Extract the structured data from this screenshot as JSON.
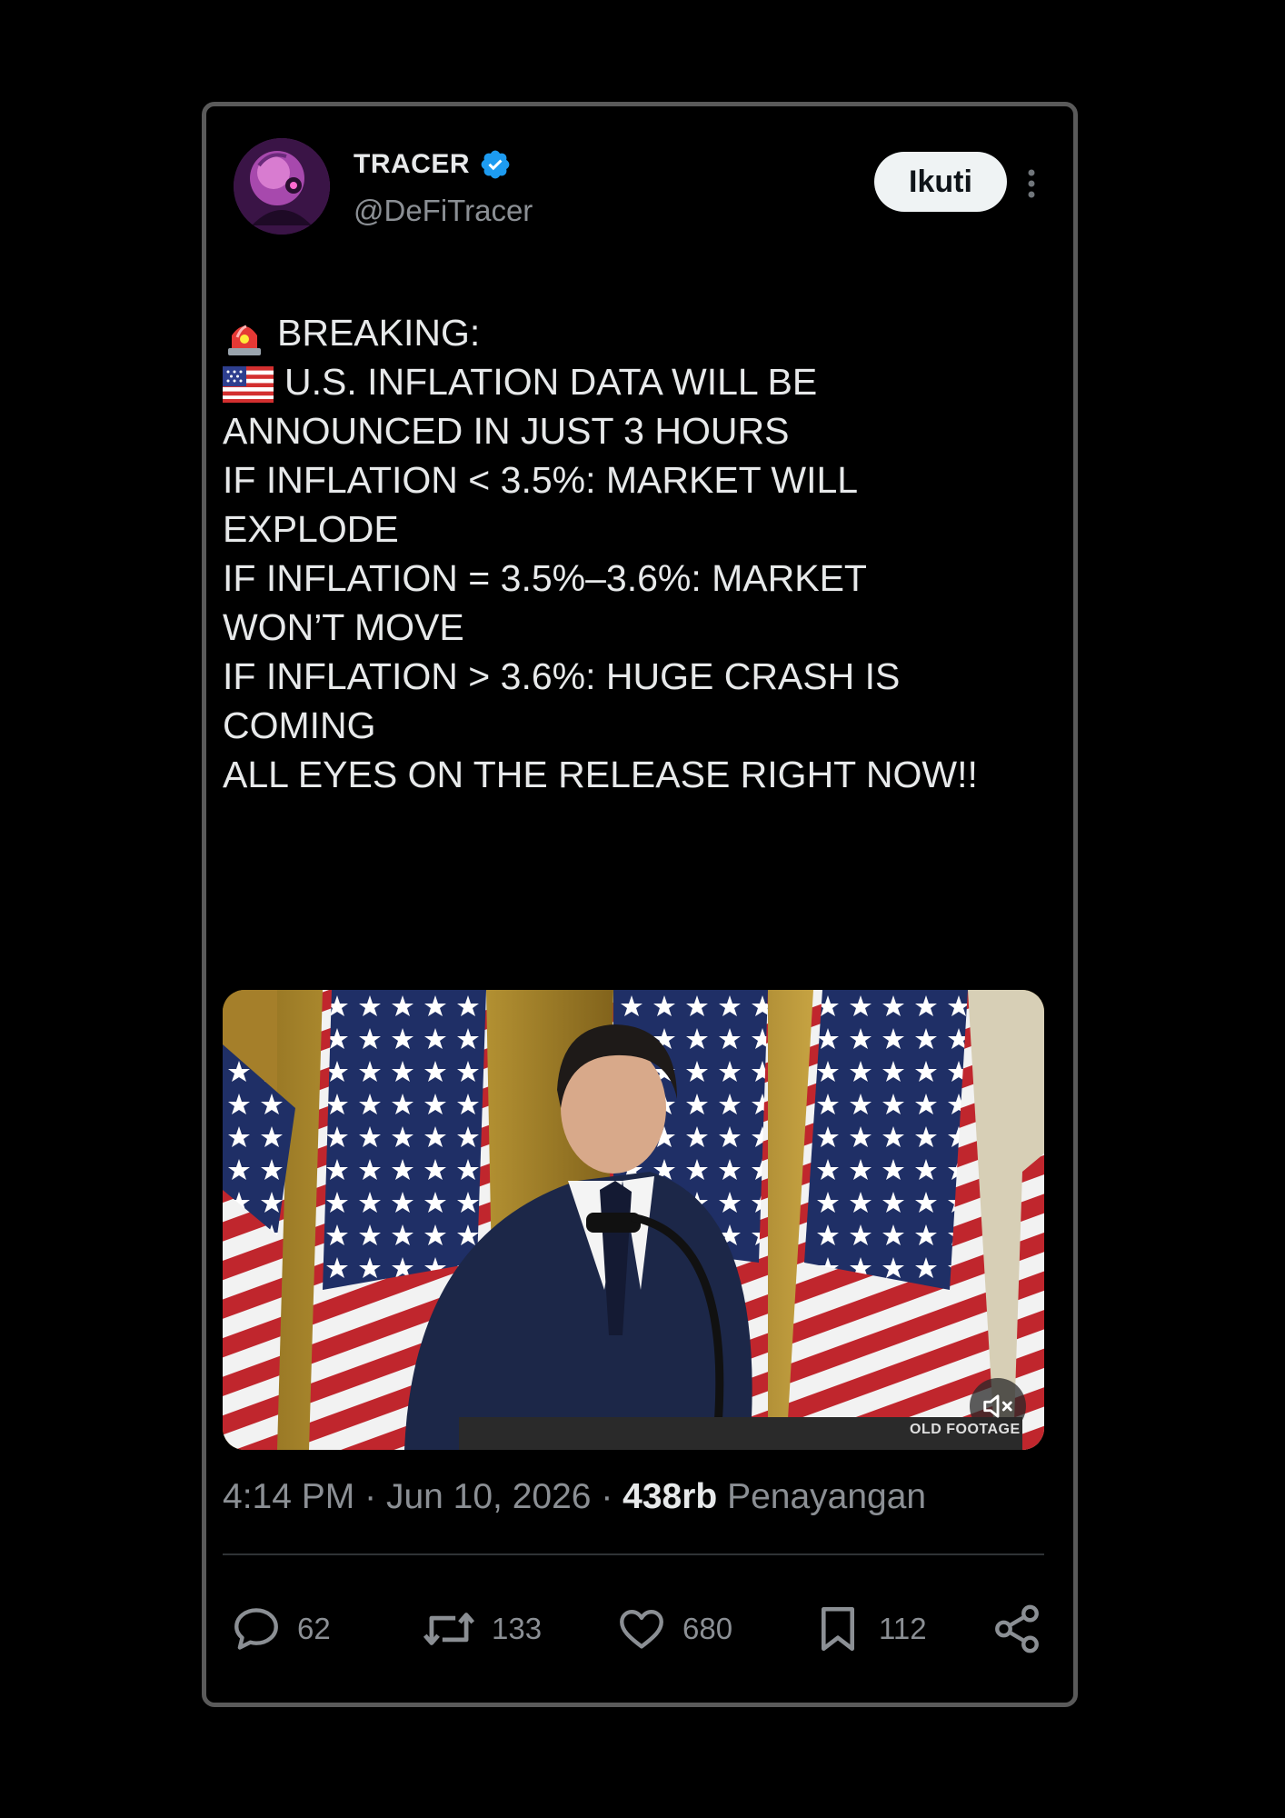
{
  "author": {
    "name": "TRACER",
    "handle": "@DeFiTracer",
    "verified": true,
    "verified_color": "#1d9bf0"
  },
  "follow_label": "Ikuti",
  "post": {
    "lines": [
      "BREAKING:",
      "U.S. INFLATION DATA WILL BE",
      "ANNOUNCED IN JUST 3 HOURS",
      "IF INFLATION < 3.5%: MARKET WILL",
      "EXPLODE",
      "IF INFLATION = 3.5%–3.6%: MARKET",
      "WON’T MOVE",
      "IF INFLATION > 3.6%: HUGE CRASH IS",
      "COMING",
      "ALL EYES ON THE RELEASE RIGHT NOW!!"
    ],
    "emoji_siren": "🚨",
    "emoji_flag": "🇺🇸"
  },
  "media": {
    "watermark": "OLD FOOTAGE",
    "muted": true
  },
  "meta": {
    "time": "4:14 PM",
    "separator": "·",
    "date": "Jun 10, 2026",
    "views_count": "438rb",
    "views_label": "Penayangan"
  },
  "actions": {
    "replies": "62",
    "reposts": "133",
    "likes": "680",
    "bookmarks": "112"
  },
  "icons": [
    "verified-badge-icon",
    "more-icon",
    "mute-icon",
    "reply-icon",
    "repost-icon",
    "like-icon",
    "bookmark-icon",
    "share-icon"
  ]
}
